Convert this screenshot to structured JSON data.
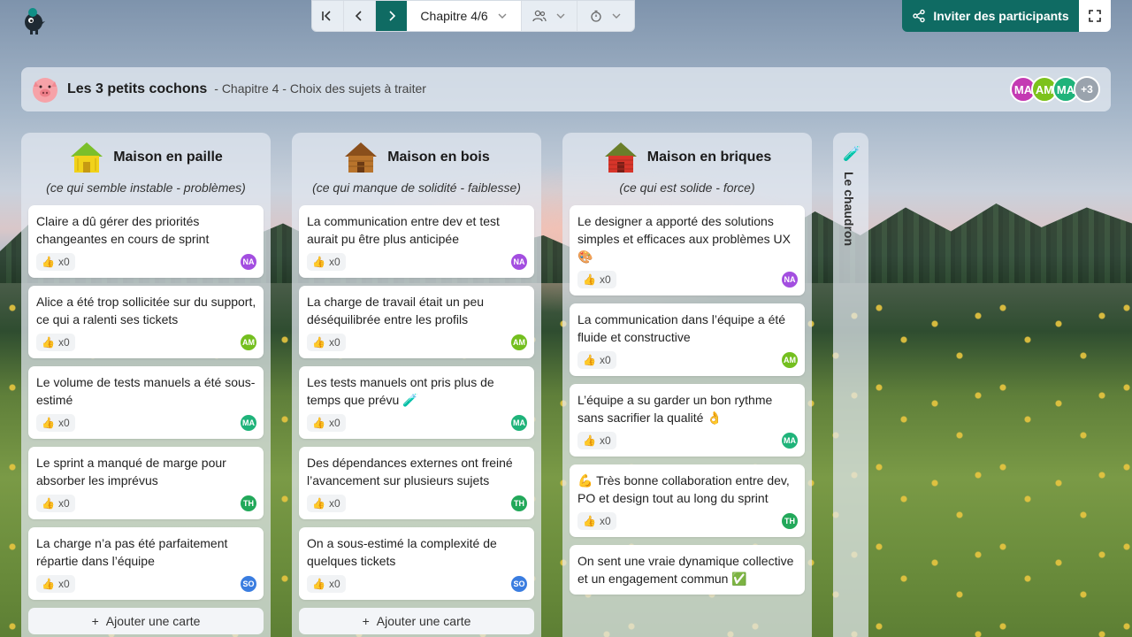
{
  "toolbar": {
    "chapter_label": "Chapitre 4/6",
    "invite_label": "Inviter des participants"
  },
  "header": {
    "title": "Les 3 petits cochons",
    "subtitle": "- Chapitre 4 - Choix des sujets à traiter",
    "participants": [
      {
        "initials": "MA",
        "color": "#c43ab3"
      },
      {
        "initials": "AM",
        "color": "#7cc21c"
      },
      {
        "initials": "MA",
        "color": "#1fb37a"
      }
    ],
    "more_count": "+3"
  },
  "columns": [
    {
      "title": "Maison en paille",
      "subtitle": "(ce qui semble instable - problèmes)",
      "add_label": "Ajouter une carte",
      "cards": [
        {
          "text": "Claire a dû gérer des priorités changeantes en cours de sprint",
          "votes": "x0",
          "author": "NA",
          "color": "#a34ee0"
        },
        {
          "text": "Alice a été trop sollicitée sur du support, ce qui a ralenti ses tickets",
          "votes": "x0",
          "author": "AM",
          "color": "#74bf1f"
        },
        {
          "text": "Le volume de tests manuels a été sous-estimé",
          "votes": "x0",
          "author": "MA",
          "color": "#1fb37a"
        },
        {
          "text": "Le sprint a manqué de marge pour absorber les imprévus",
          "votes": "x0",
          "author": "TH",
          "color": "#22a85a"
        },
        {
          "text": "La charge n’a pas été parfaitement répartie dans l’équipe",
          "votes": "x0",
          "author": "SO",
          "color": "#3a7de0"
        }
      ]
    },
    {
      "title": "Maison en bois",
      "subtitle": "(ce qui manque de solidité - faiblesse)",
      "add_label": "Ajouter une carte",
      "cards": [
        {
          "text": "La communication entre dev et test aurait pu être plus anticipée",
          "votes": "x0",
          "author": "NA",
          "color": "#a34ee0"
        },
        {
          "text": "La charge de travail était un peu déséquilibrée entre les profils",
          "votes": "x0",
          "author": "AM",
          "color": "#74bf1f"
        },
        {
          "text": "Les tests manuels ont pris plus de temps que prévu 🧪",
          "votes": "x0",
          "author": "MA",
          "color": "#1fb37a"
        },
        {
          "text": "Des dépendances externes ont freiné l’avancement sur plusieurs sujets",
          "votes": "x0",
          "author": "TH",
          "color": "#22a85a"
        },
        {
          "text": "On a sous-estimé la complexité de quelques tickets",
          "votes": "x0",
          "author": "SO",
          "color": "#3a7de0"
        }
      ]
    },
    {
      "title": "Maison en briques",
      "subtitle": "(ce qui est solide - force)",
      "cards": [
        {
          "text": "Le designer a apporté des solutions simples et efficaces aux problèmes UX 🎨",
          "votes": "x0",
          "author": "NA",
          "color": "#a34ee0"
        },
        {
          "text": "La communication dans l’équipe a été fluide et constructive",
          "votes": "x0",
          "author": "AM",
          "color": "#74bf1f"
        },
        {
          "text": "L’équipe a su garder un bon rythme sans sacrifier la qualité 👌",
          "votes": "x0",
          "author": "MA",
          "color": "#1fb37a"
        },
        {
          "text": "💪 Très bonne collaboration entre dev, PO et design tout au long du sprint",
          "votes": "x0",
          "author": "TH",
          "color": "#22a85a"
        },
        {
          "text": "On sent une vraie dynamique collective et un engagement commun ✅",
          "votes": "",
          "author": "",
          "color": "#3a7de0"
        }
      ]
    }
  ],
  "cauldron": {
    "label": "Le chaudron"
  }
}
